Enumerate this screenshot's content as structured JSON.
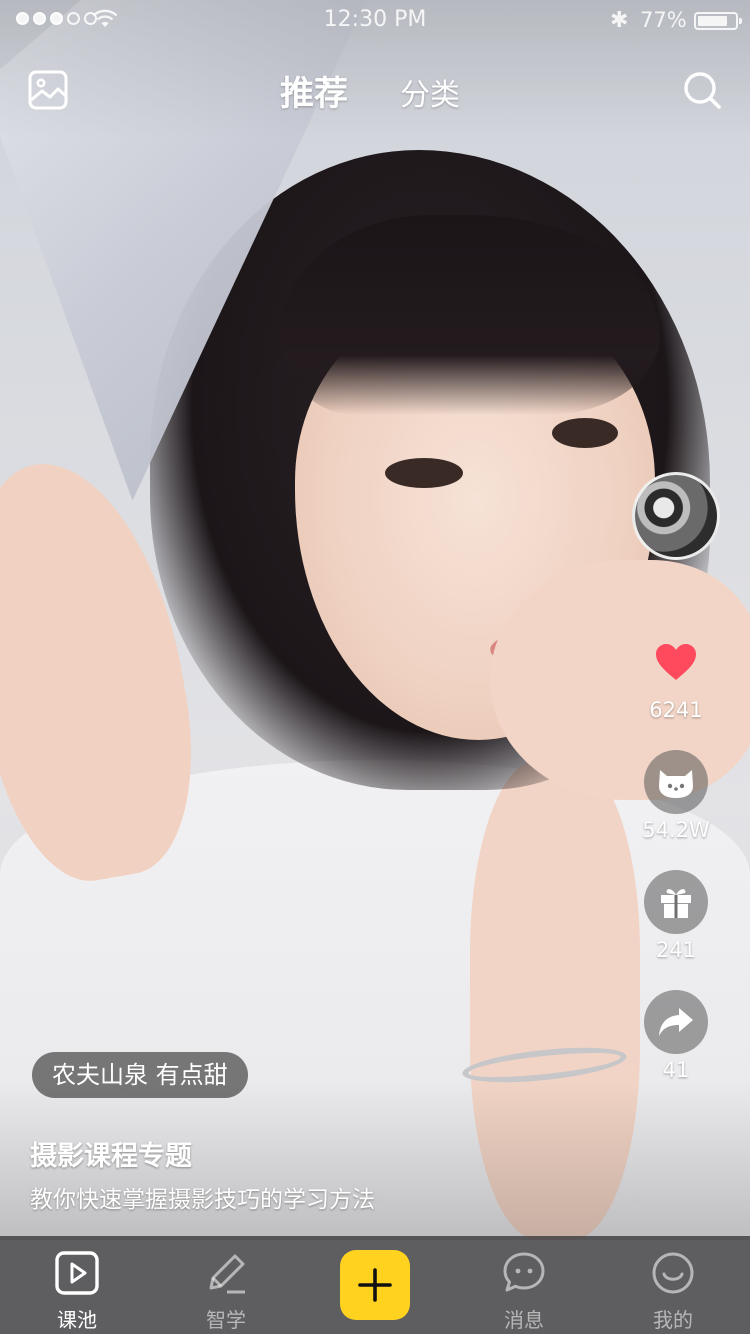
{
  "status_bar": {
    "time": "12:30 PM",
    "battery_text": "77%",
    "battery_level": 0.77,
    "bluetooth_symbol": "✱"
  },
  "header": {
    "tabs": [
      {
        "label": "推荐",
        "active": true
      },
      {
        "label": "分类",
        "active": false
      }
    ],
    "left_icon": "gallery-icon",
    "right_icon": "search-icon"
  },
  "actions": {
    "avatar_icon": "creator-avatar",
    "likes": "6241",
    "cat_count": "54.2W",
    "gifts": "241",
    "shares": "41",
    "like_color": "#ff4a5e"
  },
  "content": {
    "tag": "农夫山泉 有点甜",
    "title": "摄影课程专题",
    "description": "教你快速掌握摄影技巧的学习方法"
  },
  "bottom_nav": {
    "items": [
      {
        "label": "课池",
        "icon": "play-square-icon",
        "active": true
      },
      {
        "label": "智学",
        "icon": "pencil-icon",
        "active": false
      },
      {
        "label": "",
        "icon": "plus-icon",
        "active": false
      },
      {
        "label": "消息",
        "icon": "chat-bubble-icon",
        "active": false
      },
      {
        "label": "我的",
        "icon": "smile-icon",
        "active": false
      }
    ],
    "accent": "#ffd21f"
  }
}
